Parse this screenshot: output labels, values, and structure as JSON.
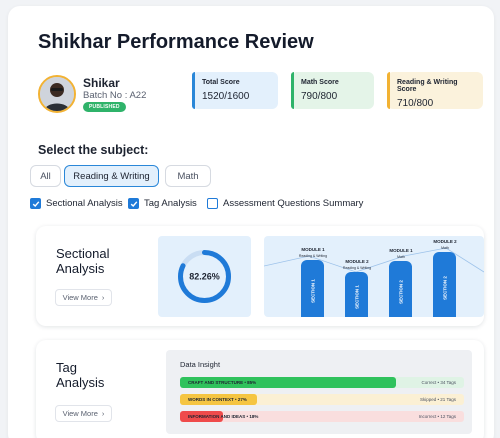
{
  "header": {
    "title": "Shikhar Performance Review"
  },
  "profile": {
    "name": "Shikar",
    "batch": "Batch No : A22",
    "status": "PUBLISHED"
  },
  "scores": [
    {
      "label": "Total Score",
      "value": "1520/1600",
      "accent": "#2a87d8"
    },
    {
      "label": "Math Score",
      "value": "790/800",
      "accent": "#2fb36a"
    },
    {
      "label": "Reading & Writing Score",
      "value": "710/800",
      "accent": "#f2b233"
    }
  ],
  "subject": {
    "label": "Select the subject:",
    "tabs": [
      "All",
      "Reading & Writing",
      "Math"
    ],
    "selected": "Reading & Writing"
  },
  "filters": [
    {
      "label": "Sectional Analysis",
      "checked": true
    },
    {
      "label": "Tag Analysis",
      "checked": true
    },
    {
      "label": "Assessment Questions Summary",
      "checked": false
    }
  ],
  "sectional": {
    "title_line1": "Sectional",
    "title_line2": "Analysis",
    "view_more": "View More",
    "donut_label": "82.26%",
    "donut_value": 82.26,
    "modules": [
      {
        "title": "MODULE 1",
        "subject": "Reading & Writing",
        "section": "SECTION 1"
      },
      {
        "title": "MODULE 2",
        "subject": "Reading & Writing",
        "section": "SECTION 1"
      },
      {
        "title": "MODULE 1",
        "subject": "Math",
        "section": "SECTION 2"
      },
      {
        "title": "MODULE 2",
        "subject": "Math",
        "section": "SECTION 2"
      }
    ]
  },
  "tag": {
    "title_line1": "Tag",
    "title_line2": "Analysis",
    "view_more": "View More",
    "insight_title": "Data Insight",
    "rows": [
      {
        "name": "CRAFT AND STRUCTURE • 85%",
        "stat": "Correct • 34 Tags",
        "fill_fraction": 0.76,
        "fill": "#2fc25c",
        "track": "#dff3e5"
      },
      {
        "name": "WORDS IN CONTEXT • 27%",
        "stat": "Skipped • 21 Tags",
        "fill_fraction": 0.27,
        "fill": "#f5c542",
        "track": "#fbf0d4"
      },
      {
        "name": "INFORMATION AND IDEAS • 18%",
        "stat": "Incorrect • 12 Tags",
        "fill_fraction": 0.15,
        "fill": "#ef4b4b",
        "track": "#f9dede"
      }
    ]
  }
}
